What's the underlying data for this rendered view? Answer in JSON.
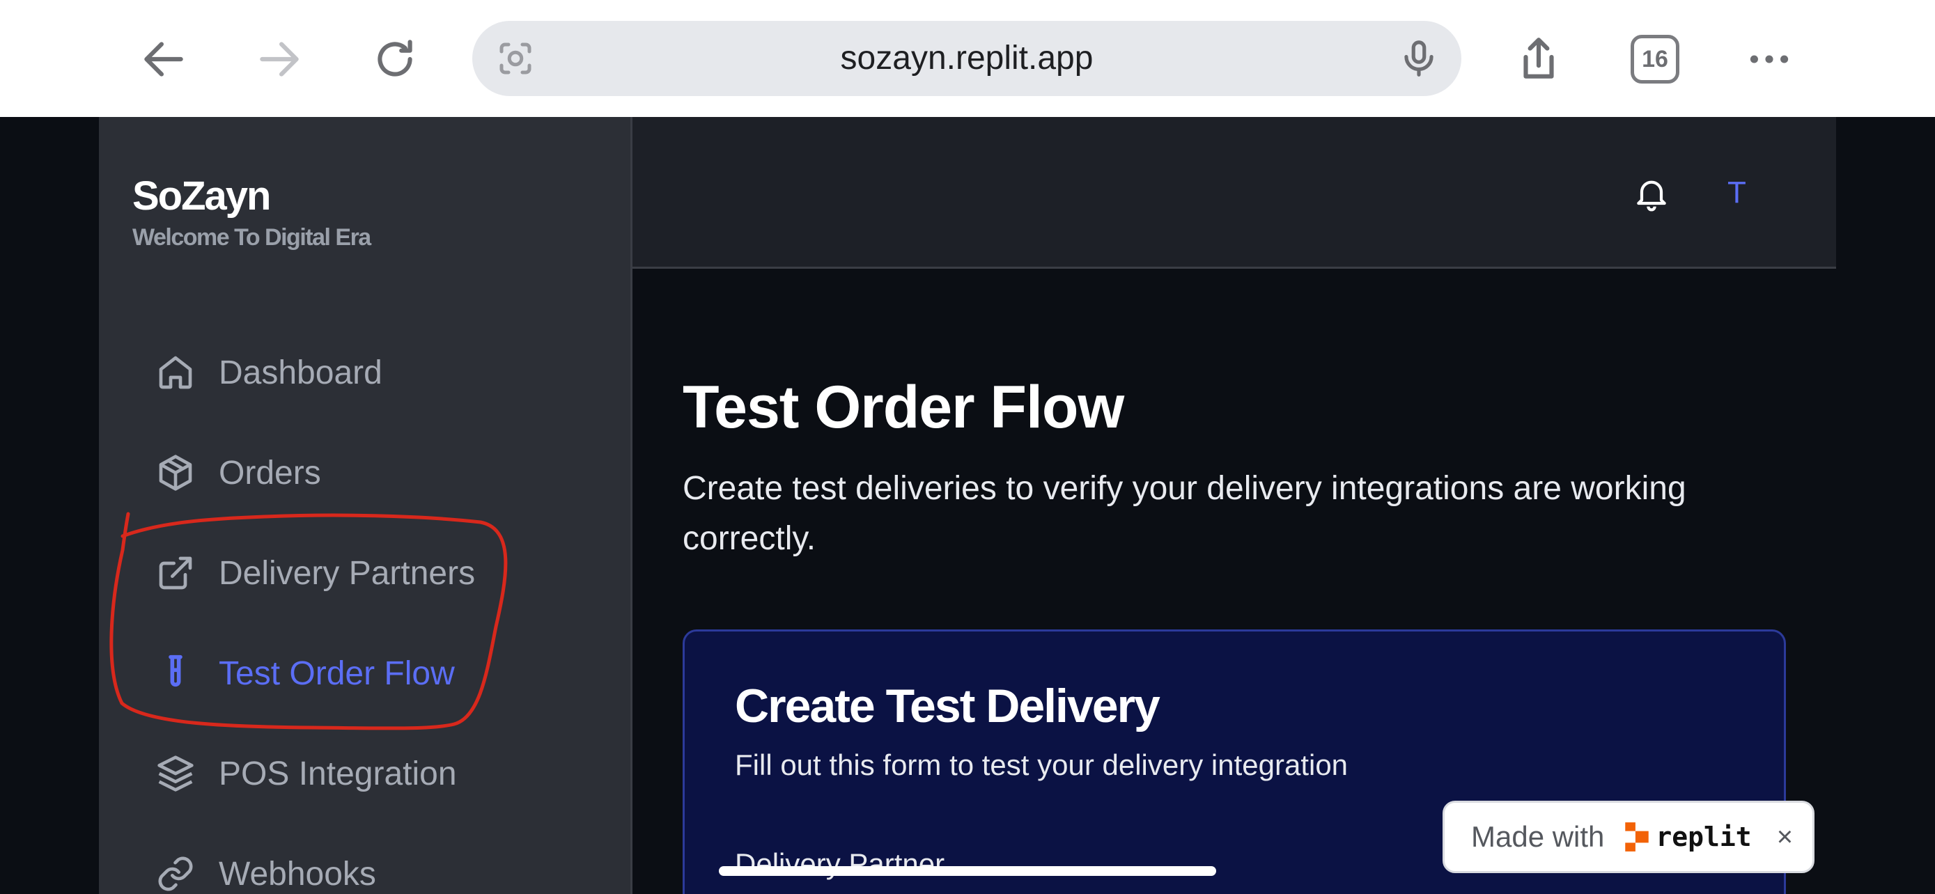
{
  "browser": {
    "url": "sozayn.replit.app",
    "tab_count": "16"
  },
  "sidebar": {
    "brand_title": "SoZayn",
    "brand_subtitle": "Welcome To Digital Era",
    "items": [
      {
        "label": "Dashboard",
        "icon": "home-icon"
      },
      {
        "label": "Orders",
        "icon": "package-icon"
      },
      {
        "label": "Delivery Partners",
        "icon": "external-link-icon"
      },
      {
        "label": "Test Order Flow",
        "icon": "test-tube-icon",
        "active": true
      },
      {
        "label": "POS Integration",
        "icon": "layers-icon"
      },
      {
        "label": "Webhooks",
        "icon": "link-icon"
      }
    ]
  },
  "header": {
    "avatar_initial": "T"
  },
  "main": {
    "title": "Test Order Flow",
    "description": "Create test deliveries to verify your delivery integrations are working correctly.",
    "card": {
      "title": "Create Test Delivery",
      "subtitle": "Fill out this form to test your delivery integration",
      "field_label": "Delivery Partner"
    }
  },
  "badge": {
    "made_with": "Made with",
    "brand": "replit",
    "close": "×"
  },
  "colors": {
    "accent": "#5b6ef5",
    "sidebar_bg": "#2c2f36",
    "page_bg": "#0b0e14",
    "card_bg": "#0b1244",
    "annotation": "#d8281c"
  }
}
